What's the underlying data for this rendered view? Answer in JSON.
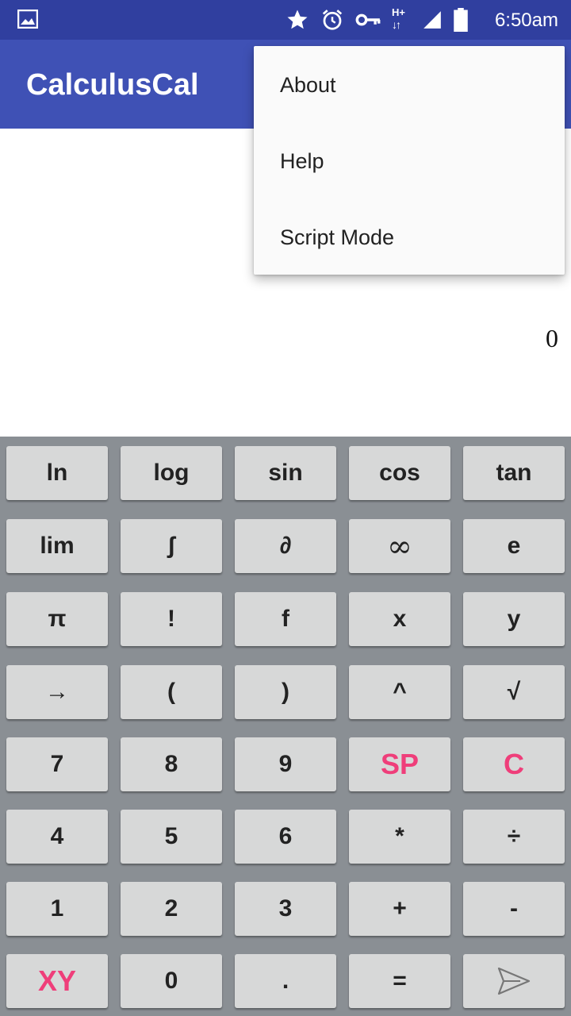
{
  "status_bar": {
    "icons": [
      "gallery-icon",
      "star-icon",
      "alarm-icon",
      "vpn-key-icon",
      "network-hplus-icon",
      "signal-icon",
      "battery-icon"
    ],
    "network_label": "H+",
    "time": "6:50am"
  },
  "app_bar": {
    "title": "CalculusCal"
  },
  "display": {
    "value": "0"
  },
  "menu": {
    "items": [
      "About",
      "Help",
      "Script Mode"
    ]
  },
  "colors": {
    "status_bar": "#303f9f",
    "app_bar": "#3f51b5",
    "keypad_bg": "#8a8f94",
    "key_bg": "#d7d8d8",
    "accent": "#ef3e7a"
  },
  "keypad": {
    "rows": [
      [
        "ln",
        "log",
        "sin",
        "cos",
        "tan"
      ],
      [
        "lim",
        "ʃ",
        "∂",
        "∞",
        "e"
      ],
      [
        "π",
        "!",
        "f",
        "x",
        "y"
      ],
      [
        "→",
        "(",
        ")",
        "^",
        "√"
      ],
      [
        "7",
        "8",
        "9",
        "SP",
        "C"
      ],
      [
        "4",
        "5",
        "6",
        "*",
        "÷"
      ],
      [
        "1",
        "2",
        "3",
        "+",
        "-"
      ],
      [
        "XY",
        "0",
        ".",
        "=",
        ""
      ]
    ],
    "accent_keys": [
      "SP",
      "C",
      "XY"
    ],
    "send_icon": "send-icon"
  }
}
